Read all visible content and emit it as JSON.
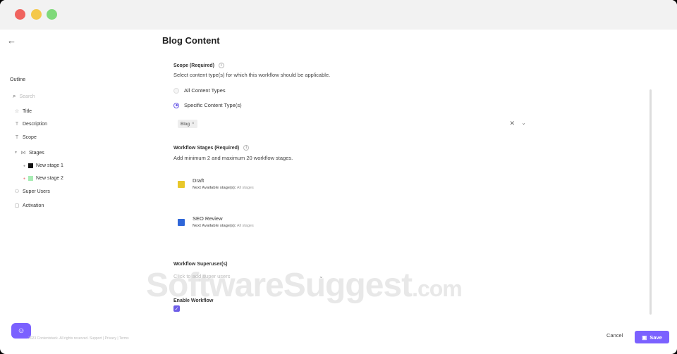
{
  "header": {
    "back_icon": "arrow-left-icon",
    "title": "Blog Content"
  },
  "outline": {
    "title": "Outline",
    "search_placeholder": "Search",
    "items": [
      {
        "label": "Title",
        "icon": "star-icon"
      },
      {
        "label": "Description",
        "icon": "text-icon"
      },
      {
        "label": "Scope",
        "icon": "text-icon"
      },
      {
        "label": "Stages",
        "icon": "stages-icon"
      },
      {
        "label": "New stage 1",
        "color": "#111111"
      },
      {
        "label": "New stage 2",
        "color": "#a8ecb4"
      },
      {
        "label": "Super Users",
        "icon": "users-icon"
      },
      {
        "label": "Activation",
        "icon": "toggle-icon"
      }
    ]
  },
  "scope": {
    "label": "Scope (Required)",
    "helper": "Select content type(s) for which this workflow should be applicable.",
    "option_all": "All Content Types",
    "option_specific": "Specific Content Type(s)",
    "selected_option": "specific",
    "tag": "Blog",
    "tag_remove": "×"
  },
  "stages": {
    "label": "Workflow Stages (Required)",
    "helper": "Add minimum 2 and maximum 20 workflow stages.",
    "items": [
      {
        "name": "Draft",
        "next_label": "Next Available stage(s):",
        "next_value": "All stages",
        "color": "#e8c72a"
      },
      {
        "name": "SEO Review",
        "next_label": "Next Available stage(s):",
        "next_value": "All stages",
        "color": "#2f66d8"
      }
    ]
  },
  "superusers": {
    "label": "Workflow Superuser(s)",
    "placeholder": "Click to add super users"
  },
  "activation": {
    "label": "Enable Workflow",
    "checked": true
  },
  "footer": {
    "cancel": "Cancel",
    "save": "Save",
    "note": "2023 Contentstack. All rights reserved. Support | Privacy | Terms"
  },
  "watermark": {
    "main": "SoftwareSuggest",
    "suffix": ".com"
  },
  "colors": {
    "accent": "#7b61ff",
    "radio_accent": "#6c5ce7"
  }
}
